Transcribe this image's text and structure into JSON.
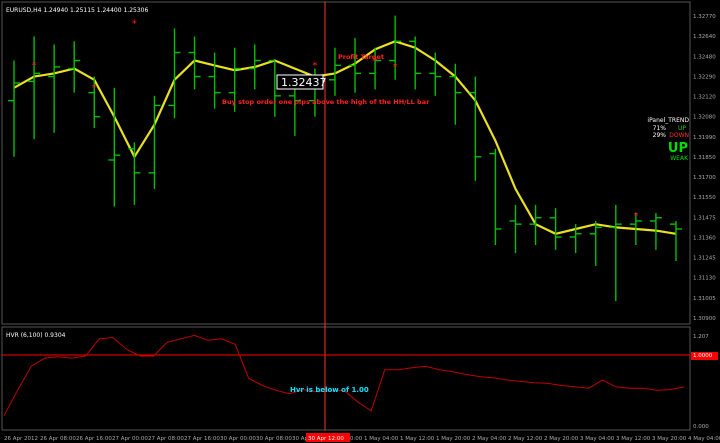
{
  "chart_data": [
    {
      "type": "bar",
      "title": "EURUSD,H4  1.24940 1.25115 1.24400 1.25306",
      "price_labels": [
        "1.32770",
        "1.32640",
        "1.32480",
        "1.32290",
        "1.32120",
        "1.32080",
        "1.31990",
        "1.31850",
        "1.31700",
        "1.31550",
        "1.31475",
        "1.31360",
        "1.31245",
        "1.31130",
        "1.31005",
        "1.30900"
      ],
      "ylim": [
        1.3087,
        1.3284
      ],
      "current_price": "1.32437",
      "x_tick_labels": [
        "26 Apr 2012",
        "26 Apr 08:00",
        "26 Apr 16:00",
        "27 Apr 00:00",
        "27 Apr 08:00",
        "27 Apr 16:00",
        "30 Apr 00:00",
        "30 Apr 08:00",
        "30 Apr 16:00",
        "1 May 00:00",
        "1 May 04:00",
        "1 May 12:00",
        "1 May 20:00",
        "2 May 04:00",
        "2 May 12:00",
        "2 May 20:00",
        "3 May 04:00",
        "3 May 12:00",
        "3 May 20:00",
        "4 May 04:00"
      ],
      "highlighted_x_label": "30 Apr 12:00",
      "bars": [
        {
          "h": 1.325,
          "l": 1.319,
          "o": 1.3225,
          "c": 1.3236
        },
        {
          "h": 1.3265,
          "l": 1.3201,
          "o": 1.3237,
          "c": 1.3242
        },
        {
          "h": 1.326,
          "l": 1.3205,
          "o": 1.324,
          "c": 1.3246
        },
        {
          "h": 1.3262,
          "l": 1.323,
          "o": 1.3245,
          "c": 1.325
        },
        {
          "h": 1.324,
          "l": 1.3208,
          "o": 1.323,
          "c": 1.3215
        },
        {
          "h": 1.3233,
          "l": 1.3159,
          "o": 1.3188,
          "c": 1.3191
        },
        {
          "h": 1.3199,
          "l": 1.316,
          "o": 1.3195,
          "c": 1.318
        },
        {
          "h": 1.3228,
          "l": 1.317,
          "o": 1.318,
          "c": 1.3222
        },
        {
          "h": 1.327,
          "l": 1.3214,
          "o": 1.3222,
          "c": 1.3255
        },
        {
          "h": 1.3265,
          "l": 1.3232,
          "o": 1.3255,
          "c": 1.324
        },
        {
          "h": 1.3255,
          "l": 1.322,
          "o": 1.324,
          "c": 1.323
        },
        {
          "h": 1.3258,
          "l": 1.3218,
          "o": 1.323,
          "c": 1.3245
        },
        {
          "h": 1.326,
          "l": 1.3232,
          "o": 1.3245,
          "c": 1.325
        },
        {
          "h": 1.325,
          "l": 1.3215,
          "o": 1.325,
          "c": 1.3228
        },
        {
          "h": 1.324,
          "l": 1.3203,
          "o": 1.3228,
          "c": 1.3225
        },
        {
          "h": 1.3245,
          "l": 1.3215,
          "o": 1.3225,
          "c": 1.3238
        },
        {
          "h": 1.3258,
          "l": 1.3228,
          "o": 1.3238,
          "c": 1.3247
        },
        {
          "h": 1.3264,
          "l": 1.323,
          "o": 1.3247,
          "c": 1.3242
        },
        {
          "h": 1.3258,
          "l": 1.3232,
          "o": 1.3242,
          "c": 1.325
        },
        {
          "h": 1.3278,
          "l": 1.3238,
          "o": 1.325,
          "c": 1.3262
        },
        {
          "h": 1.3265,
          "l": 1.3232,
          "o": 1.3262,
          "c": 1.3242
        },
        {
          "h": 1.3255,
          "l": 1.3228,
          "o": 1.3242,
          "c": 1.324
        },
        {
          "h": 1.3248,
          "l": 1.321,
          "o": 1.324,
          "c": 1.323
        },
        {
          "h": 1.324,
          "l": 1.3175,
          "o": 1.323,
          "c": 1.319
        },
        {
          "h": 1.3195,
          "l": 1.3135,
          "o": 1.3192,
          "c": 1.3145
        },
        {
          "h": 1.316,
          "l": 1.313,
          "o": 1.315,
          "c": 1.3148
        },
        {
          "h": 1.316,
          "l": 1.3135,
          "o": 1.3148,
          "c": 1.3152
        },
        {
          "h": 1.3158,
          "l": 1.3132,
          "o": 1.3152,
          "c": 1.314
        },
        {
          "h": 1.3148,
          "l": 1.313,
          "o": 1.314,
          "c": 1.3142
        },
        {
          "h": 1.315,
          "l": 1.3122,
          "o": 1.3142,
          "c": 1.3146
        },
        {
          "h": 1.316,
          "l": 1.31,
          "o": 1.3146,
          "c": 1.3148
        },
        {
          "h": 1.3155,
          "l": 1.3135,
          "o": 1.3148,
          "c": 1.315
        },
        {
          "h": 1.3155,
          "l": 1.3132,
          "o": 1.315,
          "c": 1.3152
        },
        {
          "h": 1.315,
          "l": 1.3125,
          "o": 1.3148,
          "c": 1.3145
        }
      ],
      "moving_average": [
        1.3233,
        1.324,
        1.3242,
        1.3245,
        1.3238,
        1.3215,
        1.319,
        1.321,
        1.3238,
        1.325,
        1.3247,
        1.3244,
        1.3246,
        1.325,
        1.3245,
        1.324,
        1.3242,
        1.3248,
        1.3257,
        1.3262,
        1.3258,
        1.325,
        1.324,
        1.3225,
        1.32,
        1.317,
        1.3148,
        1.3142,
        1.3145,
        1.3148,
        1.3146,
        1.3145,
        1.3144,
        1.3142
      ],
      "star_signals": [
        {
          "bar": 1,
          "price": 1.3247
        },
        {
          "bar": 4,
          "price": 1.3233
        },
        {
          "bar": 6,
          "price": 1.3273
        },
        {
          "bar": 15,
          "price": 1.3247
        },
        {
          "bar": 18,
          "price": 1.325
        },
        {
          "bar": 19,
          "price": 1.3246
        },
        {
          "bar": 31,
          "price": 1.3153
        }
      ],
      "colors": {
        "bars": "#00c000",
        "ma": "#e8e020",
        "signal": "#ff2020",
        "crosshair": "#ff3030",
        "axis": "#aaaaaa"
      }
    },
    {
      "type": "line",
      "title": "HVR (6,100) 0.9304",
      "ylim": [
        0.0,
        1.4
      ],
      "scale_labels": [
        "1.207",
        "1.0000",
        "0.000"
      ],
      "level": 1.0,
      "values": [
        0.18,
        0.55,
        0.9,
        1.02,
        1.04,
        1.02,
        1.05,
        1.3,
        1.32,
        1.15,
        1.05,
        1.05,
        1.25,
        1.3,
        1.35,
        1.28,
        1.3,
        1.22,
        0.72,
        0.62,
        0.55,
        0.5,
        0.56,
        0.53,
        0.54,
        0.55,
        0.38,
        0.25,
        0.85,
        0.85,
        0.88,
        0.9,
        0.85,
        0.82,
        0.78,
        0.75,
        0.73,
        0.7,
        0.68,
        0.66,
        0.65,
        0.62,
        0.6,
        0.58,
        0.7,
        0.6,
        0.58,
        0.58,
        0.55,
        0.56,
        0.6
      ],
      "colors": {
        "line": "#c00000",
        "level": "#ff0000"
      }
    }
  ],
  "annotations": {
    "profit_target": "Profit Target",
    "stop_entry": "Buy stop order one pips above the high of the HH/LL bar",
    "hvr_note": "Hvr is below of  1.00"
  },
  "ipanel": {
    "title": "iPanel_TREND",
    "row1_pct": "71%",
    "row1_dir": "UP",
    "row2_pct": "29%",
    "row2_dir": "DOWN",
    "big_dir": "UP",
    "strength": "WEAK"
  }
}
